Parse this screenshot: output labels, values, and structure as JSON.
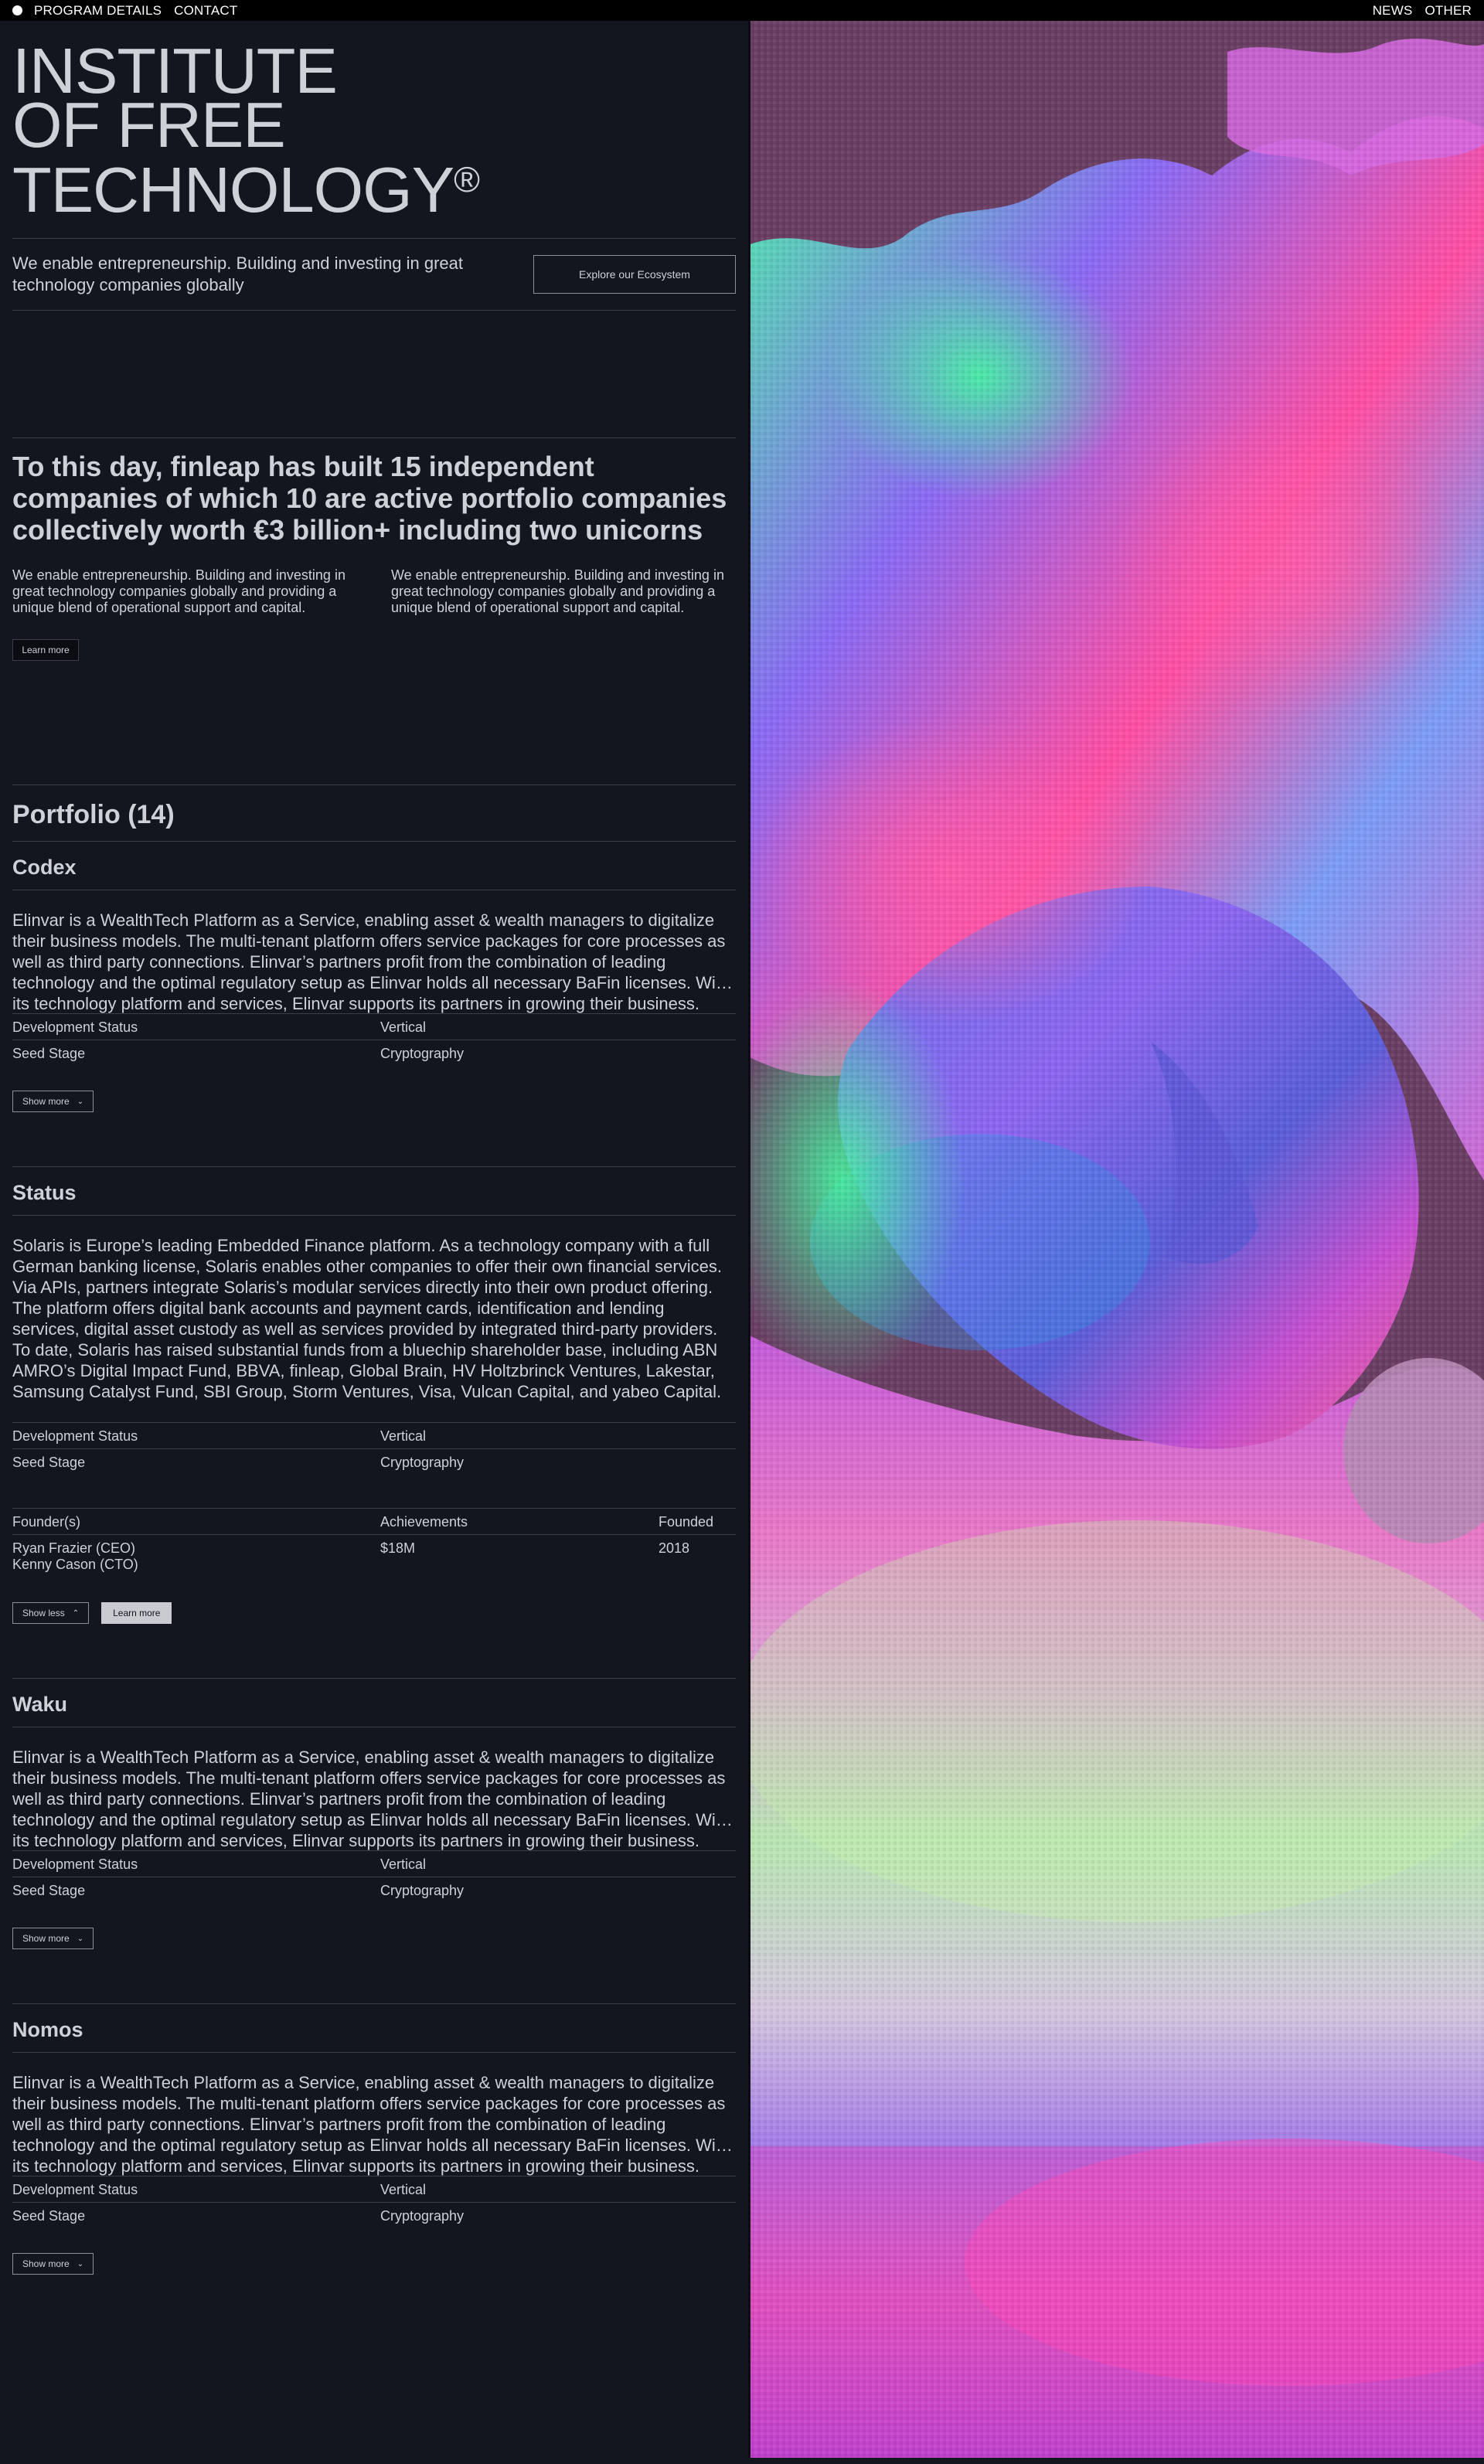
{
  "nav": {
    "left": [
      "PROGRAM DETAILS",
      "CONTACT"
    ],
    "right": [
      "NEWS",
      "OTHER"
    ]
  },
  "hero": {
    "title_lines": [
      "INSTITUTE",
      "OF FREE",
      "TECHNOLOGY"
    ],
    "registered": "®",
    "tagline": "We enable entrepreneurship. Building and investing in great technology companies globally",
    "cta": "Explore our Ecosystem"
  },
  "stats": {
    "headline": "To this day, finleap has built 15 independent companies of which 10 are active portfolio companies collectively worth €3 billion+ including two unicorns",
    "col1": "We enable entrepreneurship. Building and investing in great technology companies globally and providing a unique blend of operational support and capital.",
    "col2": "We enable entrepreneurship. Building and investing in great technology companies globally and providing a unique blend of operational support and capital.",
    "learn_more": "Learn more"
  },
  "portfolio": {
    "title": "Portfolio (14)",
    "companies": [
      {
        "name": "Codex",
        "description": "Elinvar is a WealthTech Platform as a Service, enabling asset & wealth managers to digitalize their business models. The multi-tenant platform offers service packages for core processes as well as third party connections. Elinvar’s partners profit from the combination of leading technology and the optimal regulatory setup as Elinvar holds all necessary BaFin licenses. With its technology platform and services, Elinvar supports its partners in growing their business.",
        "status_label": "Development Status",
        "status": "Seed Stage",
        "vertical_label": "Vertical",
        "vertical": "Cryptography",
        "button": "Show more"
      },
      {
        "name": "Status",
        "description": "Solaris is Europe’s leading Embedded Finance platform. As a technology company with a full German banking license, Solaris enables other companies to offer their own financial services. Via APIs, partners integrate Solaris’s modular services directly into their own product offering. The platform offers digital bank accounts and payment cards, identification and lending services, digital asset custody as well as services provided by integrated third-party providers. To date, Solaris has raised substantial funds from a bluechip shareholder base, including ABN AMRO’s Digital Impact Fund, BBVA, finleap, Global Brain, HV Holtzbrinck Ventures, Lakestar, Samsung Catalyst Fund, SBI Group, Storm Ventures, Visa, Vulcan Capital, and yabeo Capital.",
        "status_label": "Development Status",
        "status": "Seed Stage",
        "vertical_label": "Vertical",
        "vertical": "Cryptography",
        "founders_label": "Founder(s)",
        "founders": [
          "Ryan Frazier (CEO)",
          "Kenny Cason (CTO)"
        ],
        "achievements_label": "Achievements",
        "achievements": "$18M",
        "founded_label": "Founded",
        "founded": "2018",
        "button": "Show less",
        "learn_more": "Learn more"
      },
      {
        "name": "Waku",
        "description": "Elinvar is a WealthTech Platform as a Service, enabling asset & wealth managers to digitalize their business models. The multi-tenant platform offers service packages for core processes as well as third party connections. Elinvar’s partners profit from the combination of leading technology and the optimal regulatory setup as Elinvar holds all necessary BaFin licenses. With its technology platform and services, Elinvar supports its partners in growing their business.",
        "status_label": "Development Status",
        "status": "Seed Stage",
        "vertical_label": "Vertical",
        "vertical": "Cryptography",
        "button": "Show more"
      },
      {
        "name": "Nomos",
        "description": "Elinvar is a WealthTech Platform as a Service, enabling asset & wealth managers to digitalize their business models. The multi-tenant platform offers service packages for core processes as well as third party connections. Elinvar’s partners profit from the combination of leading technology and the optimal regulatory setup as Elinvar holds all necessary BaFin licenses. With its technology platform and services, Elinvar supports its partners in growing their business.",
        "status_label": "Development Status",
        "status": "Seed Stage",
        "vertical_label": "Vertical",
        "vertical": "Cryptography",
        "button": "Show more"
      }
    ]
  },
  "icons": {
    "logo": "circle-dot-icon",
    "chevron_down": "chevron-down-icon",
    "chevron_up": "chevron-up-icon"
  },
  "colors": {
    "background": "#13151f",
    "topbar": "#000000",
    "text": "#cfd1d8",
    "rule": "#3a3e4a",
    "art_backdrop": "#6a3f64"
  }
}
